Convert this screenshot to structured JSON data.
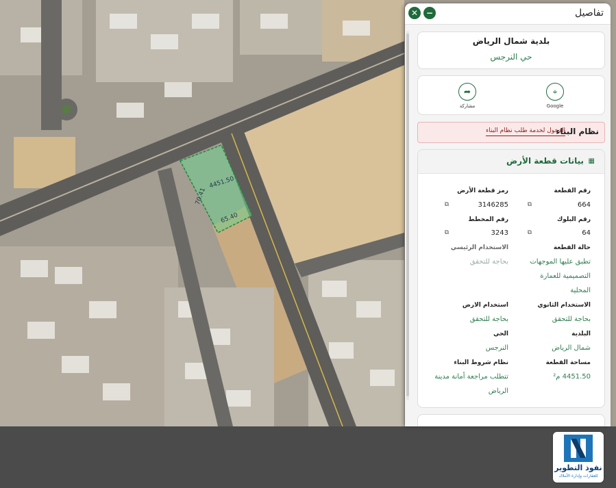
{
  "panel": {
    "title": "تفاصيل",
    "close_icon": "close-icon",
    "minimize_icon": "minus-icon"
  },
  "location": {
    "municipality": "بلدية شمال الرياض",
    "district": "حي النرجس"
  },
  "share": {
    "google_label": "Google",
    "share_label": "مشاركة"
  },
  "building_system": {
    "title": "نظام البناء",
    "link": "الدخول لخدمة طلب نظام البناء"
  },
  "land": {
    "title": "بيانات قطعة الأرض",
    "fields": {
      "plot_number_label": "رقم القطعة",
      "plot_number": "664",
      "land_code_label": "رمز قطعة الأرض",
      "land_code": "3146285",
      "block_label": "رقم البلوك",
      "block": "64",
      "plan_label": "رقم المخطط",
      "plan": "3243",
      "status_label": "حالة القطعة",
      "status_line1": "تطبق عليها الموجهات",
      "status_line2": "التصميمية للعمارة",
      "status_line3": "المحلية",
      "main_use_label": "الاستخدام الرئيسي",
      "main_use": "بحاجة للتحقق",
      "secondary_use_label": "الاستخدام الثانوي",
      "secondary_use": "بحاجة للتحقق",
      "land_use_label": "استخدام الارض",
      "land_use": "بحاجة للتحقق",
      "municipality_label": "البلدية",
      "municipality": "شمال الرياض",
      "district_label": "الحي",
      "district": "النرجس",
      "area_label": "مساحة القطعة",
      "area": "4451.50 م²",
      "conditions_label": "نظام شروط البناء",
      "conditions_line1": "تتطلب مراجعة أمانة مدينة",
      "conditions_line2": "الرياض"
    }
  },
  "map": {
    "plot_area_label": "4451.50",
    "edge_label_1": "65.40",
    "edge_label_2": "70.41"
  },
  "logo": {
    "title": "نفوذ التطوير",
    "subtitle": "للعقارات وإدارة الأملاك"
  },
  "colors": {
    "accent": "#1f6b3b",
    "alert_bg": "#fbe9e9",
    "plot_fill": "#6fd08c"
  }
}
